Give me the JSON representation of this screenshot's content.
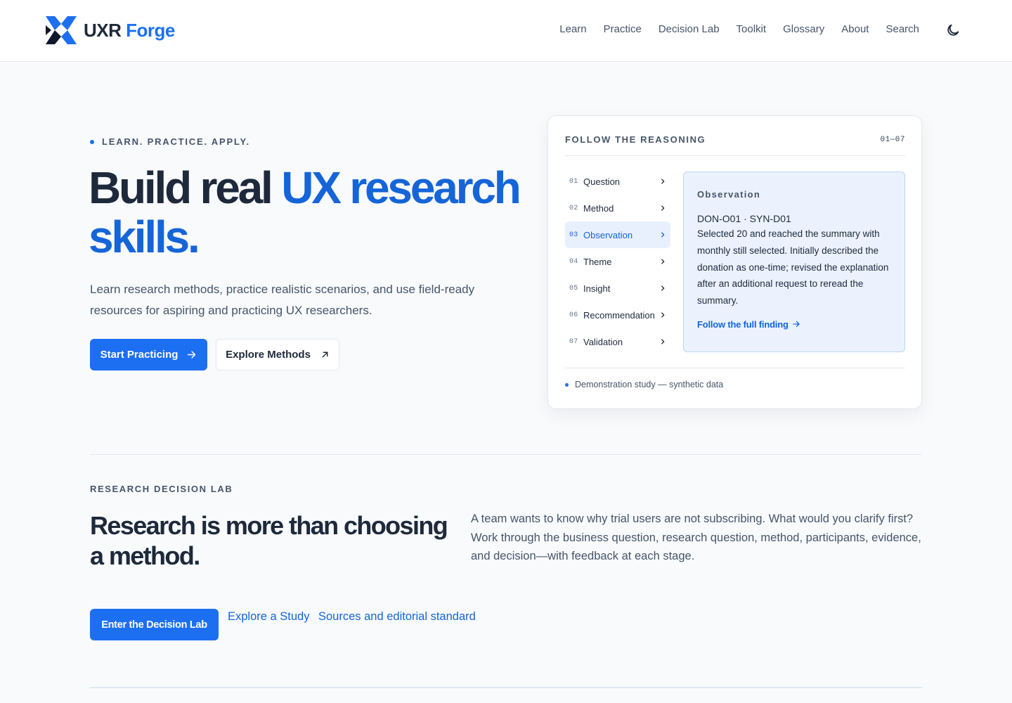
{
  "brand": {
    "name_part1": "UXR",
    "name_part2": "Forge",
    "accent_color": "#1d6ff2"
  },
  "nav": {
    "items": [
      "Learn",
      "Practice",
      "Decision Lab",
      "Toolkit",
      "Glossary",
      "About",
      "Search"
    ],
    "theme_toggle_icon": "moon-icon"
  },
  "hero": {
    "eyebrow": "LEARN. PRACTICE. APPLY.",
    "title_part1": "Build real",
    "title_highlight": "UX research skills",
    "title_end": ".",
    "subtitle": "Learn research methods, practice realistic scenarios, and use field-ready resources for aspiring and practicing UX researchers.",
    "primary_button": "Start Practicing",
    "secondary_button": "Explore Methods"
  },
  "reasoning_card": {
    "title": "FOLLOW THE REASONING",
    "range": "01—07",
    "steps": [
      {
        "num": "01",
        "label": "Question"
      },
      {
        "num": "02",
        "label": "Method"
      },
      {
        "num": "03",
        "label": "Observation"
      },
      {
        "num": "04",
        "label": "Theme"
      },
      {
        "num": "05",
        "label": "Insight"
      },
      {
        "num": "06",
        "label": "Recommendation"
      },
      {
        "num": "07",
        "label": "Validation"
      }
    ],
    "active_step": "Observation",
    "panel": {
      "title": "Observation",
      "id": "DON-O01 · SYN-D01",
      "text": "Selected 20 and reached the summary with monthly still selected. Initially described the donation as one-time; revised the explanation after an additional request to reread the summary.",
      "link": "Follow the full finding"
    },
    "footer": "Demonstration study — synthetic data"
  },
  "decision_lab": {
    "eyebrow": "RESEARCH DECISION LAB",
    "title": "Research is more than choosing a method.",
    "description": "A team wants to know why trial users are not subscribing. What would you clarify first? Work through the business question, research question, method, participants, evidence, and decision—with feedback at each stage.",
    "primary_button": "Enter the Decision Lab",
    "link_study": "Explore a Study",
    "link_sources": "Sources and editorial standard"
  }
}
